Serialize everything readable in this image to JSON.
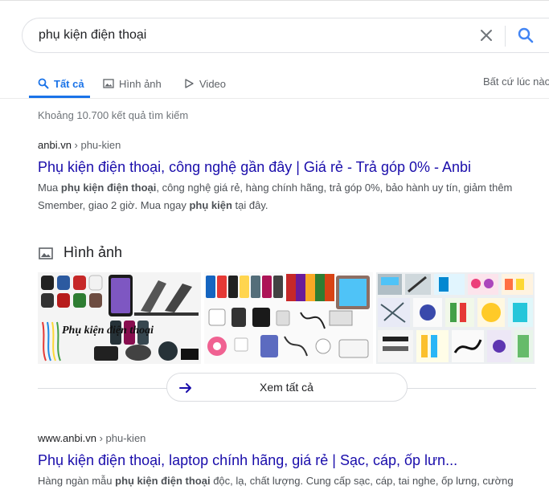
{
  "search": {
    "query": "phụ kiện điện thoại"
  },
  "tabs": [
    {
      "label": "Tất cả",
      "icon": "search-icon",
      "active": true
    },
    {
      "label": "Hình ảnh",
      "icon": "image-icon",
      "active": false
    },
    {
      "label": "Video",
      "icon": "play-icon",
      "active": false
    }
  ],
  "tools": {
    "label": "Bất cứ lúc nào"
  },
  "stats": "Khoảng 10.700 kết quả tìm kiếm",
  "result1": {
    "domain": "anbi.vn",
    "path": " › phu-kien",
    "title": "Phụ kiện điện thoại, công nghệ gần đây | Giá rẻ - Trả góp 0% - Anbi",
    "snippet": {
      "t1": "Mua ",
      "b1": "phụ kiện điện thoại",
      "t2": ", công nghệ giá rẻ, hàng chính hãng, trả góp 0%, bảo hành uy tín, giảm thêm Smember, giao 2 giờ. Mua ngay ",
      "b2": "phụ kiện",
      "t3": " tại đây."
    }
  },
  "images": {
    "header": "Hình ảnh",
    "thumb1_caption": "Phụ kiện điện thoại",
    "see_all": "Xem tất cả"
  },
  "result2": {
    "domain": "www.anbi.vn",
    "path": " › phu-kien",
    "title": "Phụ kiện điện thoại, laptop chính hãng, giá rẻ | Sạc, cáp, ốp lưn...",
    "snippet": {
      "t1": "Hàng ngàn mẫu ",
      "b1": "phụ kiện điện thoại",
      "t2": " độc, lạ, chất lượng. Cung cấp sạc, cáp, tai nghe, ốp lưng, cường"
    }
  },
  "colors": {
    "link": "#1a0dab",
    "accent": "#1a73e8",
    "muted": "#70757a"
  }
}
